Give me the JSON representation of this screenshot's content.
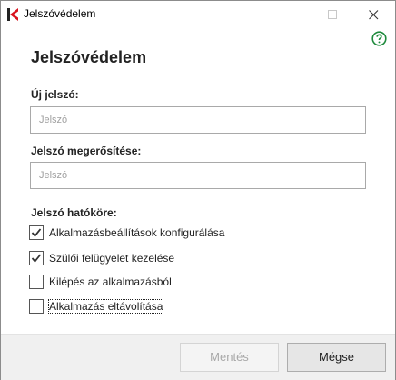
{
  "window": {
    "title": "Jelszóvédelem",
    "icon": "kaspersky-logo-icon"
  },
  "content": {
    "heading": "Jelszóvédelem",
    "new_password": {
      "label": "Új jelszó:",
      "placeholder": "Jelszó",
      "value": ""
    },
    "confirm_password": {
      "label": "Jelszó megerősítése:",
      "placeholder": "Jelszó",
      "value": ""
    },
    "scope": {
      "label": "Jelszó hatóköre:",
      "items": [
        {
          "label": "Alkalmazásbeállítások konfigurálása",
          "checked": true
        },
        {
          "label": "Szülői felügyelet kezelése",
          "checked": true
        },
        {
          "label": "Kilépés az alkalmazásból",
          "checked": false
        },
        {
          "label": "Alkalmazás eltávolítása",
          "checked": false
        }
      ]
    }
  },
  "footer": {
    "save_label": "Mentés",
    "cancel_label": "Mégse"
  },
  "colors": {
    "help": "#1e8a3c",
    "logo_red": "#d9121e",
    "footer_bg": "#f0f0f0"
  }
}
